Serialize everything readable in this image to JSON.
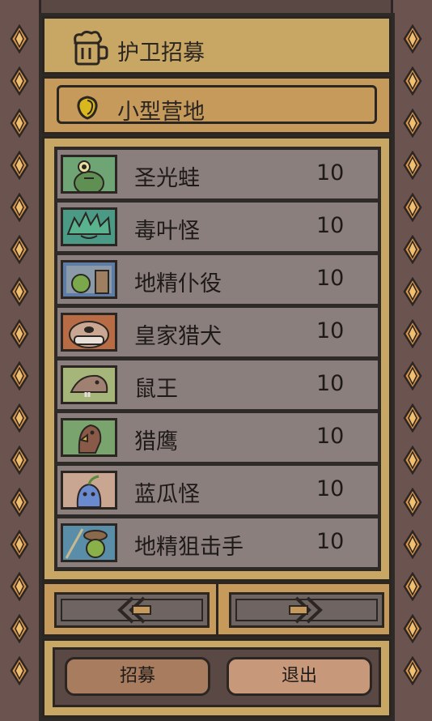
{
  "header": {
    "title": "护卫招募",
    "icon": "beer-mug-icon"
  },
  "location": {
    "name": "小型营地",
    "icon": "gold-shield-icon"
  },
  "guards": [
    {
      "name": "圣光蛙",
      "count": "10",
      "portrait": "frog-icon",
      "bg": "#6fa574"
    },
    {
      "name": "毒叶怪",
      "count": "10",
      "portrait": "leaf-monster-icon",
      "bg": "#4a9a86"
    },
    {
      "name": "地精仆役",
      "count": "10",
      "portrait": "goblin-servant-icon",
      "bg": "#5f7ca4"
    },
    {
      "name": "皇家猎犬",
      "count": "10",
      "portrait": "bulldog-icon",
      "bg": "#b86c46"
    },
    {
      "name": "鼠王",
      "count": "10",
      "portrait": "rat-king-icon",
      "bg": "#a6b67a"
    },
    {
      "name": "猎鹰",
      "count": "10",
      "portrait": "falcon-icon",
      "bg": "#7aa46e"
    },
    {
      "name": "蓝瓜怪",
      "count": "10",
      "portrait": "blue-gourd-icon",
      "bg": "#c9a692"
    },
    {
      "name": "地精狙击手",
      "count": "10",
      "portrait": "goblin-sniper-icon",
      "bg": "#5a8ea8"
    }
  ],
  "buttons": {
    "recruit": "招募",
    "exit": "退出"
  },
  "colors": {
    "panel_gold": "#c8a764",
    "row_gray": "#8b7f7d",
    "frame_dark": "#2c2623"
  }
}
